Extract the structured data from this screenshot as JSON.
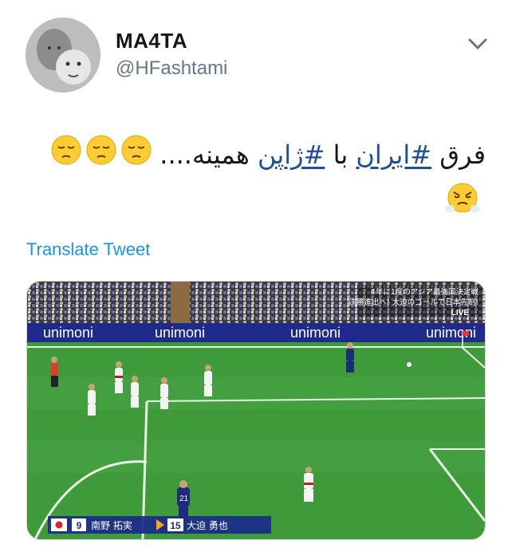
{
  "user": {
    "display_name": "MA4TA",
    "handle": "@HFashtami"
  },
  "tweet": {
    "text_start": "فرق ",
    "hashtag_1": "#ایران",
    "text_middle": " با ",
    "hashtag_2": "#ژاپن",
    "text_end": " همینه....",
    "emojis": [
      "pensive-face",
      "pensive-face",
      "pensive-face",
      "face-with-steam"
    ]
  },
  "translate_label": "Translate Tweet",
  "media": {
    "ad_board": [
      "unimoni",
      "unimoni",
      "unimoni",
      "unimoni"
    ],
    "broadcast_caption_line1": "4年に1度のアジア最強国決定戦",
    "broadcast_caption_line2": "決勝進出へ! 大迫のゴールで日本先制!",
    "live_label": "LIVE",
    "score_bar": {
      "player_1_number": "9",
      "player_1_name": "南野 拓実",
      "player_2_number": "15",
      "player_2_name": "大迫 勇也"
    },
    "jersey_numbers": [
      "21"
    ]
  },
  "colors": {
    "link": "#1b95e0",
    "hashtag": "#1f4e9a",
    "pitch": "#3f9a3a",
    "board": "#1f2a8c"
  }
}
